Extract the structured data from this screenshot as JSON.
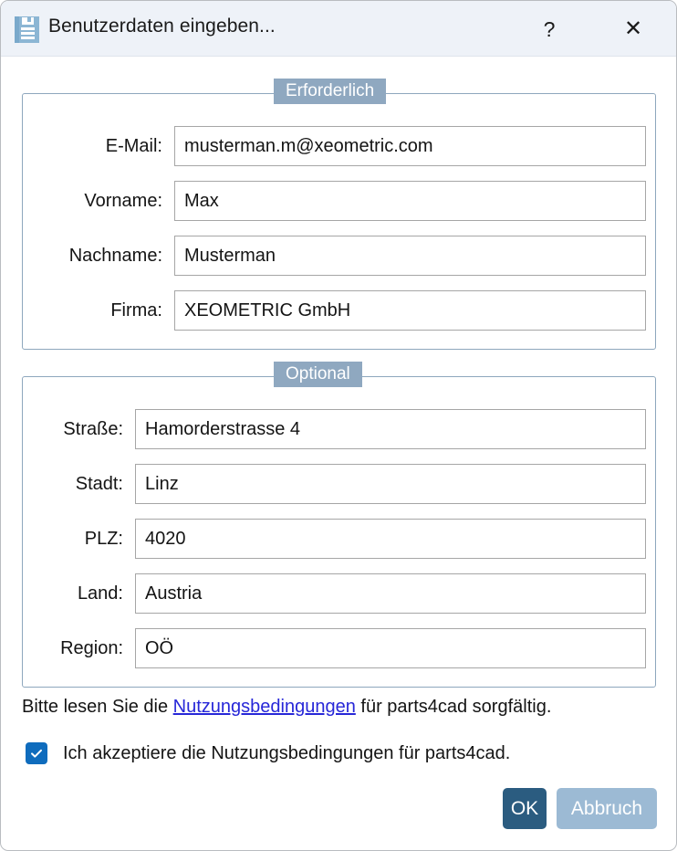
{
  "window": {
    "title": "Benutzerdaten eingeben...",
    "icon": "save-disk-icon",
    "help_label": "?",
    "close_label": "✕"
  },
  "groups": {
    "required": {
      "legend": "Erforderlich",
      "fields": [
        {
          "label": "E-Mail:",
          "value": "musterman.m@xeometric.com",
          "name": "email"
        },
        {
          "label": "Vorname:",
          "value": "Max",
          "name": "firstname"
        },
        {
          "label": "Nachname:",
          "value": "Musterman",
          "name": "lastname"
        },
        {
          "label": "Firma:",
          "value": "XEOMETRIC GmbH",
          "name": "company"
        }
      ]
    },
    "optional": {
      "legend": "Optional",
      "fields": [
        {
          "label": "Straße:",
          "value": "Hamorderstrasse 4",
          "name": "street"
        },
        {
          "label": "Stadt:",
          "value": "Linz",
          "name": "city"
        },
        {
          "label": "PLZ:",
          "value": "4020",
          "name": "zip"
        },
        {
          "label": "Land:",
          "value": "Austria",
          "name": "country"
        },
        {
          "label": "Region:",
          "value": "OÖ",
          "name": "region"
        }
      ]
    }
  },
  "terms": {
    "prefix": "Bitte lesen Sie die ",
    "link": "Nutzungsbedingungen",
    "suffix": " für parts4cad sorgfältig.",
    "accept_label": "Ich akzeptiere die Nutzungsbedingungen für parts4cad.",
    "accepted": true
  },
  "buttons": {
    "ok": "OK",
    "cancel": "Abbruch"
  },
  "colors": {
    "titlebar_bg": "#eef2f8",
    "group_border": "#8ea7bd",
    "legend_bg": "#8fa8c0",
    "link": "#2727d8",
    "checkbox": "#0f6cbd",
    "ok_bg": "#2b5c80",
    "cancel_bg": "#9cbad4"
  }
}
